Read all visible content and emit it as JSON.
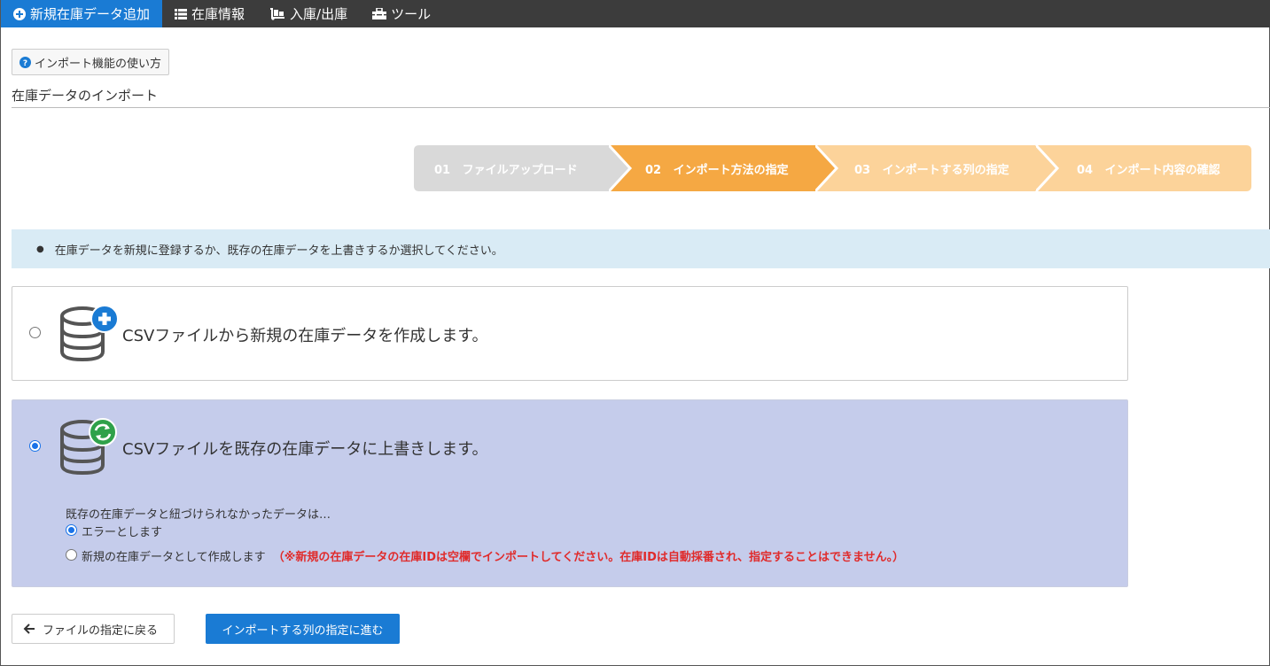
{
  "nav": {
    "items": [
      {
        "label": "新規在庫データ追加",
        "icon": "plus-circle-icon",
        "active": true
      },
      {
        "label": "在庫情報",
        "icon": "list-icon",
        "active": false
      },
      {
        "label": "入庫/出庫",
        "icon": "dolly-icon",
        "active": false
      },
      {
        "label": "ツール",
        "icon": "toolbox-icon",
        "active": false
      }
    ]
  },
  "help_button": {
    "label": "インポート機能の使い方",
    "icon": "question-circle-icon"
  },
  "page_title": "在庫データのインポート",
  "stepper": {
    "steps": [
      {
        "num": "01",
        "label": "ファイルアップロード",
        "state": "done",
        "color": "#d9d9d9"
      },
      {
        "num": "02",
        "label": "インポート方法の指定",
        "state": "current",
        "color": "#f5a843"
      },
      {
        "num": "03",
        "label": "インポートする列の指定",
        "state": "upcoming",
        "color": "#fcd39a"
      },
      {
        "num": "04",
        "label": "インポート内容の確認",
        "state": "upcoming",
        "color": "#fcd39a"
      }
    ]
  },
  "info": {
    "text": "在庫データを新規に登録するか、既存の在庫データを上書きするか選択してください。"
  },
  "options": {
    "create": {
      "label": "CSVファイルから新規の在庫データを作成します。",
      "selected": false,
      "icon": "database-plus-icon"
    },
    "overwrite": {
      "label": "CSVファイルを既存の在庫データに上書きします。",
      "selected": true,
      "icon": "database-sync-icon",
      "unmatched_prompt": "既存の在庫データと紐づけられなかったデータは…",
      "choices": [
        {
          "label": "エラーとします",
          "selected": true
        },
        {
          "label": "新規の在庫データとして作成します",
          "selected": false,
          "note": "（※新規の在庫データの在庫IDは空欄でインポートしてください。在庫IDは自動採番され、指定することはできません。）"
        }
      ]
    }
  },
  "footer": {
    "back_label": "ファイルの指定に戻る",
    "next_label": "インポートする列の指定に進む"
  },
  "colors": {
    "nav_bg": "#3c3c3c",
    "accent": "#1a7bd4",
    "selected_panel": "#c5cceb",
    "info_bg": "#d9ebf5",
    "warning": "#e02b2b"
  }
}
